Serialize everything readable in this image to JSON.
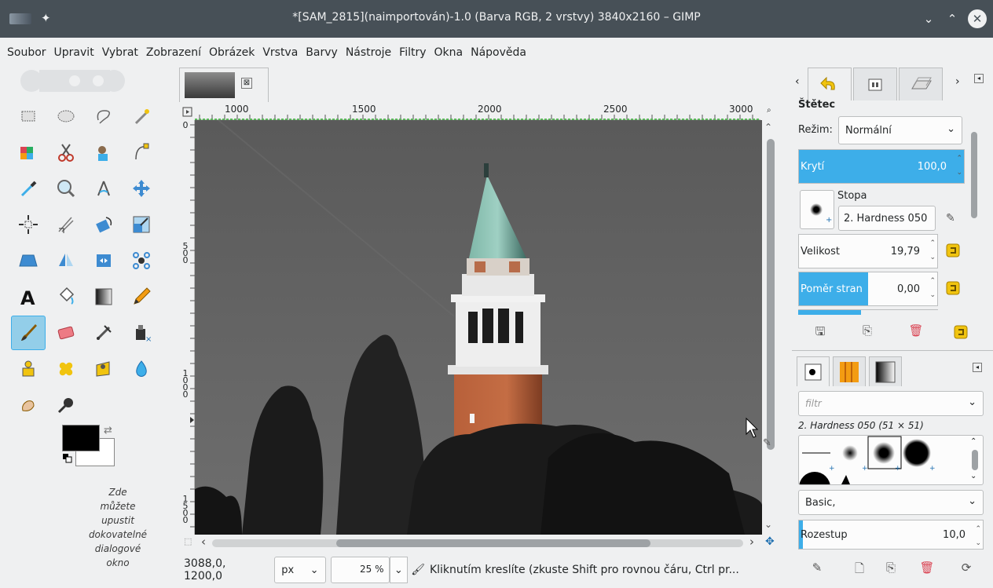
{
  "window": {
    "title": "*[SAM_2815](naimportován)-1.0 (Barva RGB, 2 vrstvy) 3840x2160 – GIMP",
    "minimize": "⌄",
    "maximize": "⌃",
    "close": "✕"
  },
  "menu": [
    "Soubor",
    "Upravit",
    "Vybrat",
    "Zobrazení",
    "Obrázek",
    "Vrstva",
    "Barvy",
    "Nástroje",
    "Filtry",
    "Okna",
    "Nápověda"
  ],
  "toolbox": {
    "tools": [
      "rect-select",
      "ellipse-select",
      "free-select",
      "fuzzy-select",
      "color-select",
      "scissors-select",
      "foreground-select",
      "paths",
      "color-picker",
      "zoom",
      "measure",
      "move",
      "align",
      "transform-3d",
      "rotate",
      "scale",
      "perspective",
      "flip",
      "unified-transform",
      "cage",
      "text",
      "bucket-fill",
      "gradient",
      "pencil",
      "paintbrush",
      "eraser",
      "airbrush",
      "ink",
      "clone",
      "heal",
      "perspective-clone",
      "blur",
      "smudge",
      "dodge-burn"
    ],
    "active_tool": "paintbrush",
    "fg_color": "#000000",
    "bg_color": "#ffffff",
    "drop_hint": [
      "Zde",
      "můžete",
      "upustit",
      "dokovatelné",
      "dialogové",
      "okno"
    ]
  },
  "image": {
    "tab_close": "⊠",
    "ruler_h": [
      "1000",
      "1500",
      "2000",
      "2500",
      "3000"
    ],
    "ruler_v": [
      [
        "0"
      ],
      [
        "5",
        "0",
        "0"
      ],
      [
        "1",
        "0",
        "0",
        "0"
      ],
      [
        "1",
        "5",
        "0",
        "0"
      ]
    ]
  },
  "status": {
    "coords": "3088,0, 1200,0",
    "unit": "px",
    "zoom": "25 %",
    "message": "Kliknutím kreslíte (zkuste Shift pro rovnou čáru, Ctrl pr..."
  },
  "dock": {
    "tool_options": {
      "title": "Štětec",
      "mode_label": "Režim:",
      "mode_value": "Normální",
      "opacity": {
        "label": "Krytí",
        "value": "100,0",
        "fraction": 1.0
      },
      "brush_label": "Stopa",
      "brush_value": "2. Hardness 050",
      "size": {
        "label": "Velikost",
        "value": "19,79",
        "fraction": 0.0
      },
      "aspect": {
        "label": "Poměr stran",
        "value": "0,00",
        "fraction": 0.5
      }
    },
    "brushes": {
      "filter_placeholder": "filtr",
      "current": "2. Hardness 050 (51 × 51)",
      "tag": "Basic,",
      "spacing": {
        "label": "Rozestup",
        "value": "10,0",
        "fraction": 0.02
      }
    }
  }
}
